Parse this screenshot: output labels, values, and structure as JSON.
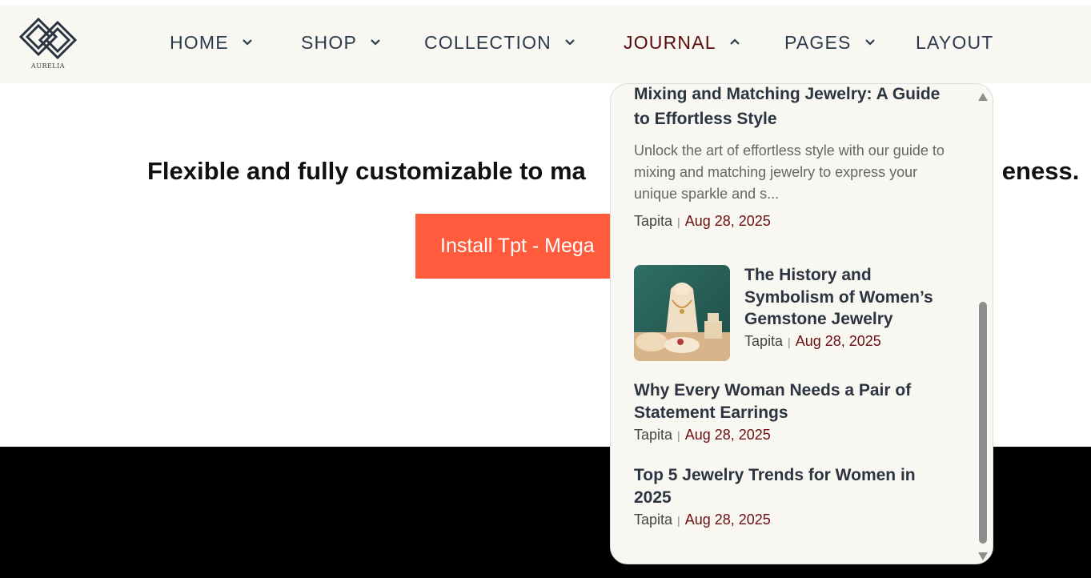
{
  "brand": {
    "name": "AURELIA"
  },
  "nav": {
    "items": [
      {
        "label": "HOME",
        "has_dropdown": true
      },
      {
        "label": "SHOP",
        "has_dropdown": true
      },
      {
        "label": "COLLECTION",
        "has_dropdown": true
      },
      {
        "label": "JOURNAL",
        "has_dropdown": true,
        "active": true
      },
      {
        "label": "PAGES",
        "has_dropdown": true
      },
      {
        "label": "LAYOUT",
        "has_dropdown": false
      }
    ]
  },
  "hero": {
    "headline_start": "Flexible and fully customizable to ma",
    "headline_end": "eness.",
    "install_button": "Install Tpt - Mega"
  },
  "journal_dropdown": {
    "posts": [
      {
        "title": "Mixing and Matching Jewelry: A Guide to Effortless Style",
        "excerpt": "Unlock the art of effortless style with our guide to mixing and matching jewelry to express your unique sparkle and s...",
        "author": "Tapita",
        "separator": "|",
        "date": "Aug 28, 2025"
      },
      {
        "title": "The History and Symbolism of Women’s Gemstone Jewelry",
        "author": "Tapita",
        "separator": "|",
        "date": "Aug 28, 2025",
        "thumbnail": "jewelry-display-image"
      },
      {
        "title": "Why Every Woman Needs a Pair of Statement Earrings",
        "author": "Tapita",
        "separator": "|",
        "date": "Aug 28, 2025"
      },
      {
        "title": "Top 5 Jewelry Trends for Women in 2025",
        "author": "Tapita",
        "separator": "|",
        "date": "Aug 28, 2025"
      }
    ],
    "scroll_position_fraction": 0.45
  },
  "colors": {
    "header_bg": "#f8f7f2",
    "nav_text": "#2b3a4a",
    "nav_active": "#5a0a0a",
    "cta": "#ff5b3c",
    "date_text": "#6a1010"
  },
  "icons": [
    "logo-mark",
    "chevron-down-icon",
    "chevron-up-icon",
    "scroll-up-arrow-icon",
    "scroll-down-arrow-icon"
  ]
}
